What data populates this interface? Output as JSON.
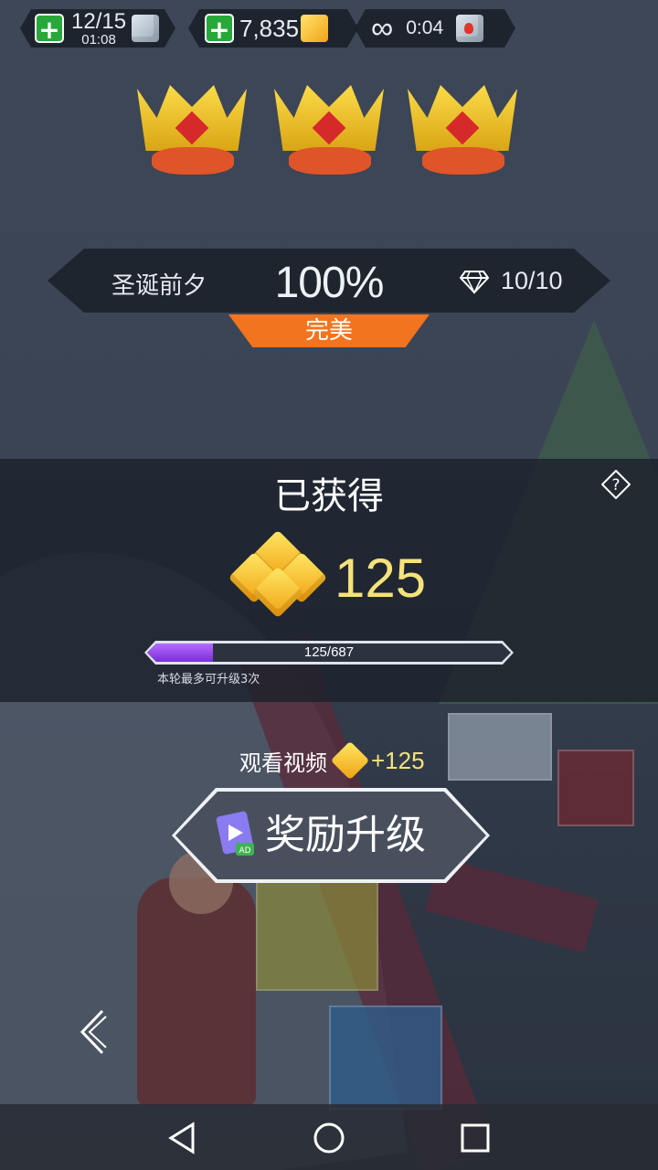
{
  "status_bar": {
    "lives": {
      "count": "12/15",
      "timer": "01:08",
      "icon": "ice-cube-icon"
    },
    "gems": {
      "count": "7,835",
      "icon": "gold-cube-icon"
    },
    "infinite": {
      "symbol": "∞",
      "timer": "0:04",
      "icon": "heart-cube-icon"
    }
  },
  "crowns": [
    "crown-icon",
    "crown-icon",
    "crown-icon"
  ],
  "level": {
    "name": "圣诞前夕",
    "percent": "100%",
    "diamonds": "10/10",
    "rank": "完美"
  },
  "earned": {
    "title": "已获得",
    "amount": "125",
    "progress": {
      "text": "125/687",
      "current": 125,
      "max": 687
    },
    "note": "本轮最多可升级3次"
  },
  "video_reward": {
    "label": "观看视频",
    "amount": "+125"
  },
  "reward_button": {
    "label": "奖励升级",
    "ad_badge": "AD"
  },
  "colors": {
    "accent_orange": "#f3741e",
    "gold_text": "#f6e27a",
    "progress_purple": "#8e3ff0"
  }
}
